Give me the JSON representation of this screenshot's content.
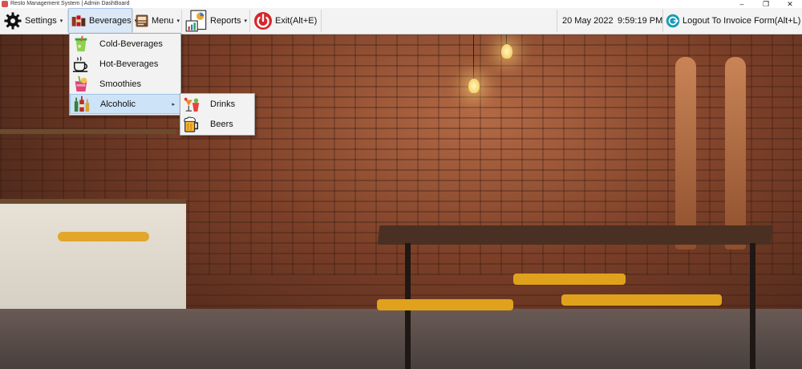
{
  "window": {
    "title": "Resto Management System  | Admin DashBoard",
    "controls": [
      "–",
      "❐",
      "✕"
    ]
  },
  "menubar": {
    "items": [
      {
        "label": "Settings",
        "icon": "gear-icon"
      },
      {
        "label": "Beverages",
        "icon": "beverages-icon"
      },
      {
        "label": "Menu",
        "icon": "menu-book-icon"
      },
      {
        "label": "Reports",
        "icon": "reports-icon"
      },
      {
        "label": "Exit(Alt+E)",
        "icon": "power-icon"
      }
    ],
    "date": "20 May 2022",
    "time": "9:59:19 PM",
    "logout_label": "Logout To Invoice Form(Alt+L)"
  },
  "beverages_menu": {
    "items": [
      {
        "label": "Cold-Beverages",
        "icon": "cold-drink-icon"
      },
      {
        "label": "Hot-Beverages",
        "icon": "hot-cup-icon"
      },
      {
        "label": "Smoothies",
        "icon": "smoothie-icon"
      },
      {
        "label": "Alcoholic",
        "icon": "bottles-icon"
      }
    ]
  },
  "alcoholic_menu": {
    "items": [
      {
        "label": "Drinks",
        "icon": "cocktail-icon"
      },
      {
        "label": "Beers",
        "icon": "beer-mug-icon"
      }
    ]
  },
  "colors": {
    "menubar_bg": "#f3f3f3",
    "active_menu_bg": "#dbe8f6",
    "highlight_bg": "#cde3f7",
    "exit_red": "#d7262b",
    "logout_teal": "#1a9bb5"
  }
}
